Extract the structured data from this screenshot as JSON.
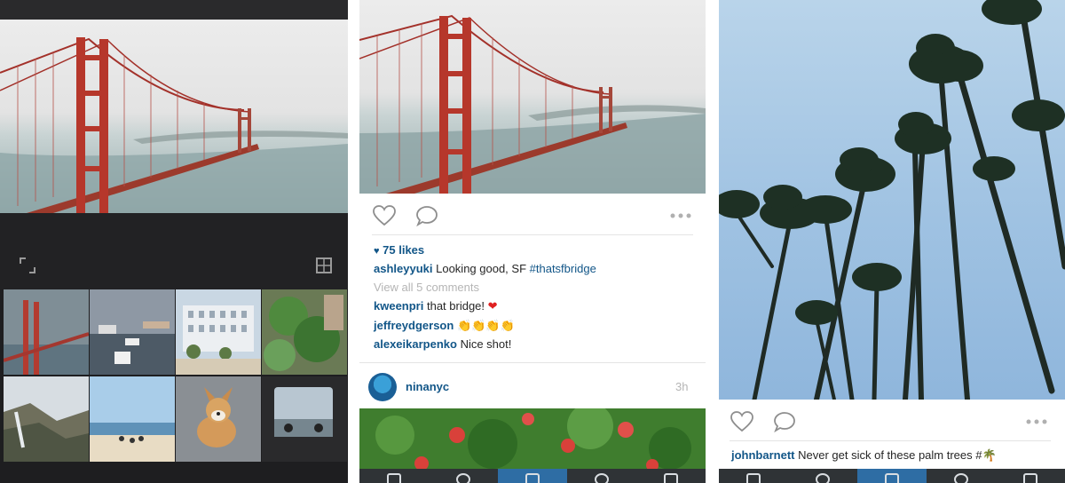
{
  "screens": {
    "gallery_screen": {
      "icons": [
        "expand-icon",
        "layout-icon"
      ]
    },
    "feed_screen": {
      "post1": {
        "likes": "75 likes",
        "caption_user": "ashleyyuki",
        "caption_text": " Looking good, SF ",
        "caption_tag": "#thatsfbridge",
        "view_comments": "View all 5 comments",
        "comments": [
          {
            "user": "kweenpri",
            "text": " that bridge! ",
            "emoji": "❤"
          },
          {
            "user": "jeffreydgerson",
            "text": " ",
            "emoji": "👏👏👏👏"
          },
          {
            "user": "alexeikarpenko",
            "text": " Nice shot!",
            "emoji": ""
          }
        ]
      },
      "post2": {
        "user": "ninanyc",
        "time": "3h"
      }
    },
    "palms_screen": {
      "caption_user": "johnbarnett",
      "caption_text": " Never get sick of these palm trees #",
      "caption_emoji": "🌴"
    }
  },
  "colors": {
    "link_blue": "#125688",
    "tab_active": "#2e6da4",
    "tab_bar": "#2f3336",
    "heart_red": "#e02020"
  }
}
